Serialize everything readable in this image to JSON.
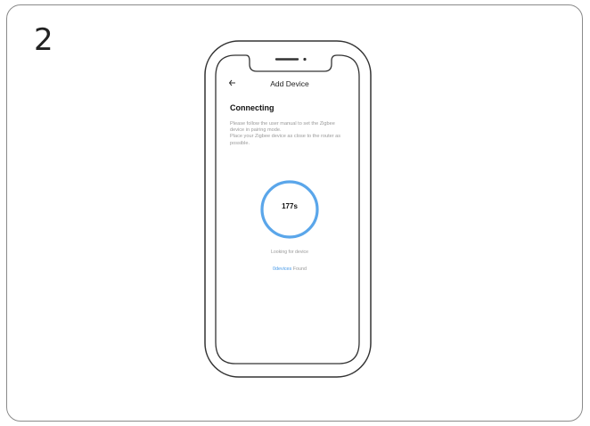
{
  "step": {
    "number": "2"
  },
  "app": {
    "title": "Add Device",
    "back_icon": "arrow-left-icon"
  },
  "content": {
    "heading": "Connecting",
    "instructions": [
      "Please follow the user manual to set the Zigbee",
      "device in pairing mode.",
      "Place your Zigbee device as close to the router as",
      "possible."
    ],
    "timer": "177s",
    "status": "Looking for device",
    "found_count": "0devices",
    "found_label": " Found"
  },
  "progress": {
    "fraction": 1.0
  },
  "colors": {
    "accent": "#4a9be8",
    "ring": "#5aa6ea",
    "muted_text": "#9a9a9a",
    "border": "#8a8a8a"
  }
}
